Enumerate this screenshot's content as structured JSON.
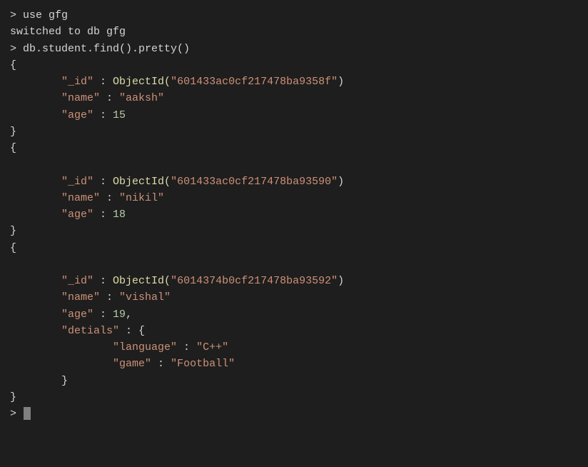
{
  "terminal": {
    "lines": [
      {
        "type": "prompt-command",
        "prompt": "> ",
        "command": "use gfg"
      },
      {
        "type": "output",
        "text": "switched to db gfg"
      },
      {
        "type": "prompt-command",
        "prompt": "> ",
        "command": "db.student.find().pretty()"
      },
      {
        "type": "brace-open",
        "text": "{"
      },
      {
        "type": "field-objectid",
        "indent": "        ",
        "key": "\"_id\"",
        "colon": " : ",
        "fn": "ObjectId",
        "val": "\"601433ac0cf217478ba9358f\""
      },
      {
        "type": "field-string",
        "indent": "        ",
        "key": "\"name\"",
        "colon": " : ",
        "val": "\"aaksh\""
      },
      {
        "type": "field-number",
        "indent": "        ",
        "key": "\"age\"",
        "colon": " : ",
        "val": "15"
      },
      {
        "type": "brace-close",
        "text": "}"
      },
      {
        "type": "brace-open",
        "text": "{"
      },
      {
        "type": "empty"
      },
      {
        "type": "field-objectid",
        "indent": "        ",
        "key": "\"_id\"",
        "colon": " : ",
        "fn": "ObjectId",
        "val": "\"601433ac0cf217478ba93590\""
      },
      {
        "type": "field-string",
        "indent": "        ",
        "key": "\"name\"",
        "colon": " : ",
        "val": "\"nikil\""
      },
      {
        "type": "field-number",
        "indent": "        ",
        "key": "\"age\"",
        "colon": " : ",
        "val": "18"
      },
      {
        "type": "brace-close",
        "text": "}"
      },
      {
        "type": "brace-open",
        "text": "{"
      },
      {
        "type": "empty"
      },
      {
        "type": "field-objectid",
        "indent": "        ",
        "key": "\"_id\"",
        "colon": " : ",
        "fn": "ObjectId",
        "val": "\"6014374b0cf217478ba93592\""
      },
      {
        "type": "field-string",
        "indent": "        ",
        "key": "\"name\"",
        "colon": " : ",
        "val": "\"vishal\""
      },
      {
        "type": "field-number-comma",
        "indent": "        ",
        "key": "\"age\"",
        "colon": " : ",
        "val": "19"
      },
      {
        "type": "field-nested-open",
        "indent": "        ",
        "key": "\"detials\"",
        "colon": " : ",
        "brace": "{"
      },
      {
        "type": "field-string",
        "indent": "                ",
        "key": "\"language\"",
        "colon": " : ",
        "val": "\"C++\""
      },
      {
        "type": "field-string",
        "indent": "                ",
        "key": "\"game\"",
        "colon": " : ",
        "val": "\"Football\""
      },
      {
        "type": "nested-brace-close",
        "indent": "        ",
        "text": "}"
      },
      {
        "type": "brace-close",
        "text": "}"
      },
      {
        "type": "prompt-cursor",
        "prompt": "> "
      }
    ]
  }
}
